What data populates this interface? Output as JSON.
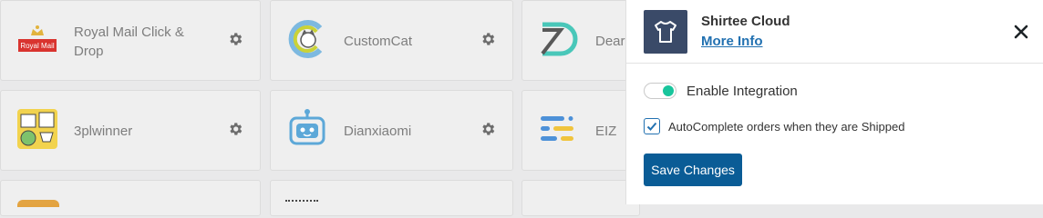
{
  "integrations": [
    {
      "name_line1": "Royal Mail Click &",
      "name_line2": "Drop",
      "logo": "royal-mail-logo",
      "logo_text": "Royal Mail"
    },
    {
      "name": "CustomCat",
      "logo": "customcat-logo"
    },
    {
      "name": "Dear",
      "logo": "dear-logo"
    },
    {
      "name": "3plwinner",
      "logo": "3plwinner-logo"
    },
    {
      "name": "Dianxiaomi",
      "logo": "robot-logo"
    },
    {
      "name": "EIZ",
      "logo": "eiz-logo"
    }
  ],
  "panel": {
    "title": "Shirtee Cloud",
    "more_info": "More Info",
    "enable_label": "Enable Integration",
    "enable_state": true,
    "autocomplete_label": "AutoComplete orders when they are Shipped",
    "autocomplete_checked": true,
    "save_label": "Save Changes"
  },
  "colors": {
    "toggle_on": "#18c59c",
    "primary": "#0a5c96",
    "link": "#2271b1",
    "logo_bg": "#3a4a68"
  }
}
